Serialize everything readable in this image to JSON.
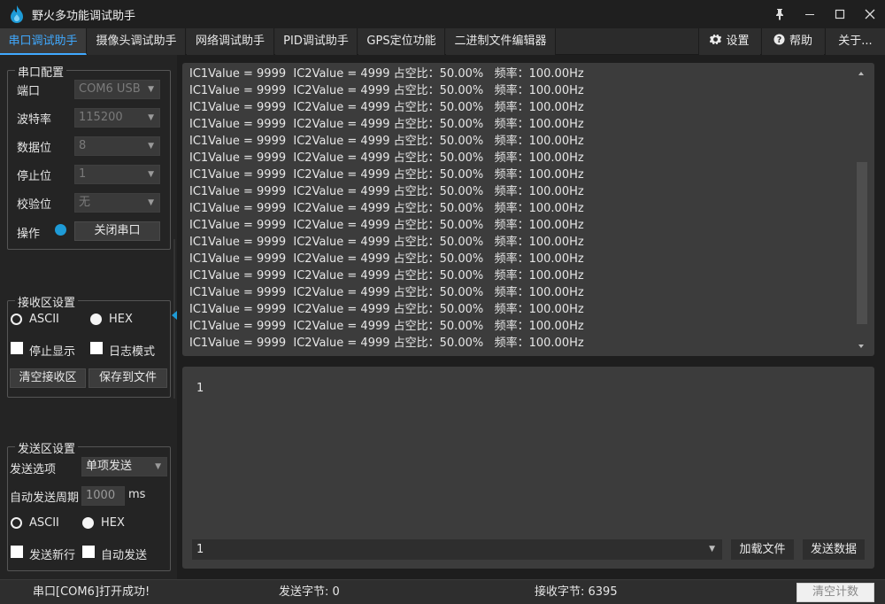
{
  "window": {
    "title": "野火多功能调试助手",
    "icons": {
      "logo": "flame-logo",
      "pin": "pin-icon",
      "minimize": "minimize-icon",
      "maximize": "maximize-icon",
      "close": "close-icon"
    }
  },
  "tabs": [
    {
      "label": "串口调试助手",
      "active": true
    },
    {
      "label": "摄像头调试助手"
    },
    {
      "label": "网络调试助手"
    },
    {
      "label": "PID调试助手"
    },
    {
      "label": "GPS定位功能"
    },
    {
      "label": "二进制文件编辑器"
    }
  ],
  "right_tabs": {
    "settings": {
      "label": "设置",
      "icon": "gear-icon"
    },
    "help": {
      "label": "帮助",
      "icon": "help-icon"
    },
    "about": {
      "label": "关于..."
    }
  },
  "serial_config": {
    "title": "串口配置",
    "port": {
      "label": "端口",
      "value": "COM6 USB"
    },
    "baud": {
      "label": "波特率",
      "value": "115200"
    },
    "data_bits": {
      "label": "数据位",
      "value": "8"
    },
    "stop_bits": {
      "label": "停止位",
      "value": "1"
    },
    "parity": {
      "label": "校验位",
      "value": "无"
    },
    "operation": {
      "label": "操作",
      "button": "关闭串口"
    }
  },
  "receive_settings": {
    "title": "接收区设置",
    "ascii": "ASCII",
    "hex": "HEX",
    "selected": "HEX",
    "stop_display": "停止显示",
    "log_mode": "日志模式",
    "clear_button": "清空接收区",
    "save_button": "保存到文件"
  },
  "send_settings": {
    "title": "发送区设置",
    "option_label": "发送选项",
    "option_value": "单项发送",
    "period_label": "自动发送周期",
    "period_value": "1000",
    "period_unit": "ms",
    "ascii": "ASCII",
    "hex": "HEX",
    "selected": "HEX",
    "send_newline": "发送新行",
    "auto_send": "自动发送"
  },
  "receive_area": {
    "lines": [
      "IC1Value = 9999  IC2Value = 4999 占空比：50.00%   频率：100.00Hz",
      "IC1Value = 9999  IC2Value = 4999 占空比：50.00%   频率：100.00Hz",
      "IC1Value = 9999  IC2Value = 4999 占空比：50.00%   频率：100.00Hz",
      "IC1Value = 9999  IC2Value = 4999 占空比：50.00%   频率：100.00Hz",
      "IC1Value = 9999  IC2Value = 4999 占空比：50.00%   频率：100.00Hz",
      "IC1Value = 9999  IC2Value = 4999 占空比：50.00%   频率：100.00Hz",
      "IC1Value = 9999  IC2Value = 4999 占空比：50.00%   频率：100.00Hz",
      "IC1Value = 9999  IC2Value = 4999 占空比：50.00%   频率：100.00Hz",
      "IC1Value = 9999  IC2Value = 4999 占空比：50.00%   频率：100.00Hz",
      "IC1Value = 9999  IC2Value = 4999 占空比：50.00%   频率：100.00Hz",
      "IC1Value = 9999  IC2Value = 4999 占空比：50.00%   频率：100.00Hz",
      "IC1Value = 9999  IC2Value = 4999 占空比：50.00%   频率：100.00Hz",
      "IC1Value = 9999  IC2Value = 4999 占空比：50.00%   频率：100.00Hz",
      "IC1Value = 9999  IC2Value = 4999 占空比：50.00%   频率：100.00Hz",
      "IC1Value = 9999  IC2Value = 4999 占空比：50.00%   频率：100.00Hz",
      "IC1Value = 9999  IC2Value = 4999 占空比：50.00%   频率：100.00Hz",
      "IC1Value = 9999  IC2Value = 4999 占空比：50.00%   频率：100.00Hz"
    ]
  },
  "send_area": {
    "text": "1",
    "combo_value": "1",
    "load_file_button": "加载文件",
    "send_button": "发送数据"
  },
  "status_bar": {
    "message": "串口[COM6]打开成功!",
    "sent_bytes": "发送字节: 0",
    "received_bytes": "接收字节: 6395",
    "clear_count_button": "清空计数"
  },
  "colors": {
    "accent": "#40a9ff",
    "led": "#1e9bd7",
    "background": "#1e1e1e",
    "panel": "#3c3c3c"
  }
}
